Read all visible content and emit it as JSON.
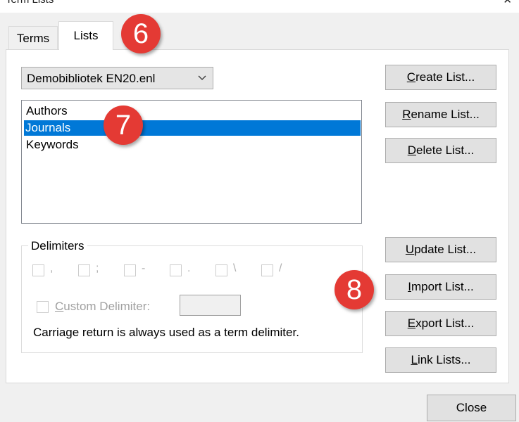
{
  "window": {
    "title": "Term Lists",
    "close_icon": "close-icon"
  },
  "tabs": [
    {
      "label": "Terms",
      "active": false
    },
    {
      "label": "Lists",
      "active": true
    }
  ],
  "library_select": {
    "value": "Demobibliotek EN20.enl",
    "icon": "chevron-down-icon"
  },
  "lists": {
    "items": [
      "Authors",
      "Journals",
      "Keywords"
    ],
    "selected": "Journals",
    "selected_color": "#0078d7"
  },
  "buttons": {
    "create": {
      "accel": "C",
      "rest": "reate List..."
    },
    "rename": {
      "accel": "R",
      "rest": "ename List..."
    },
    "delete": {
      "accel": "D",
      "rest": "elete List..."
    },
    "update": {
      "accel": "U",
      "rest": "pdate List..."
    },
    "import": {
      "accel": "I",
      "rest": "mport List..."
    },
    "export": {
      "accel": "E",
      "rest": "xport List..."
    },
    "link": {
      "accel": "L",
      "rest": "ink Lists..."
    },
    "close": "Close"
  },
  "delimiters": {
    "legend": "Delimiters",
    "symbols": [
      ",",
      ";",
      "-",
      ".",
      "\\",
      "/"
    ],
    "custom_accel": "C",
    "custom_rest": "ustom Delimiter:",
    "note": "Carriage return is always used as a term delimiter."
  },
  "annotations": {
    "six": "6",
    "seven": "7",
    "eight": "8",
    "color": "#e43a34"
  }
}
